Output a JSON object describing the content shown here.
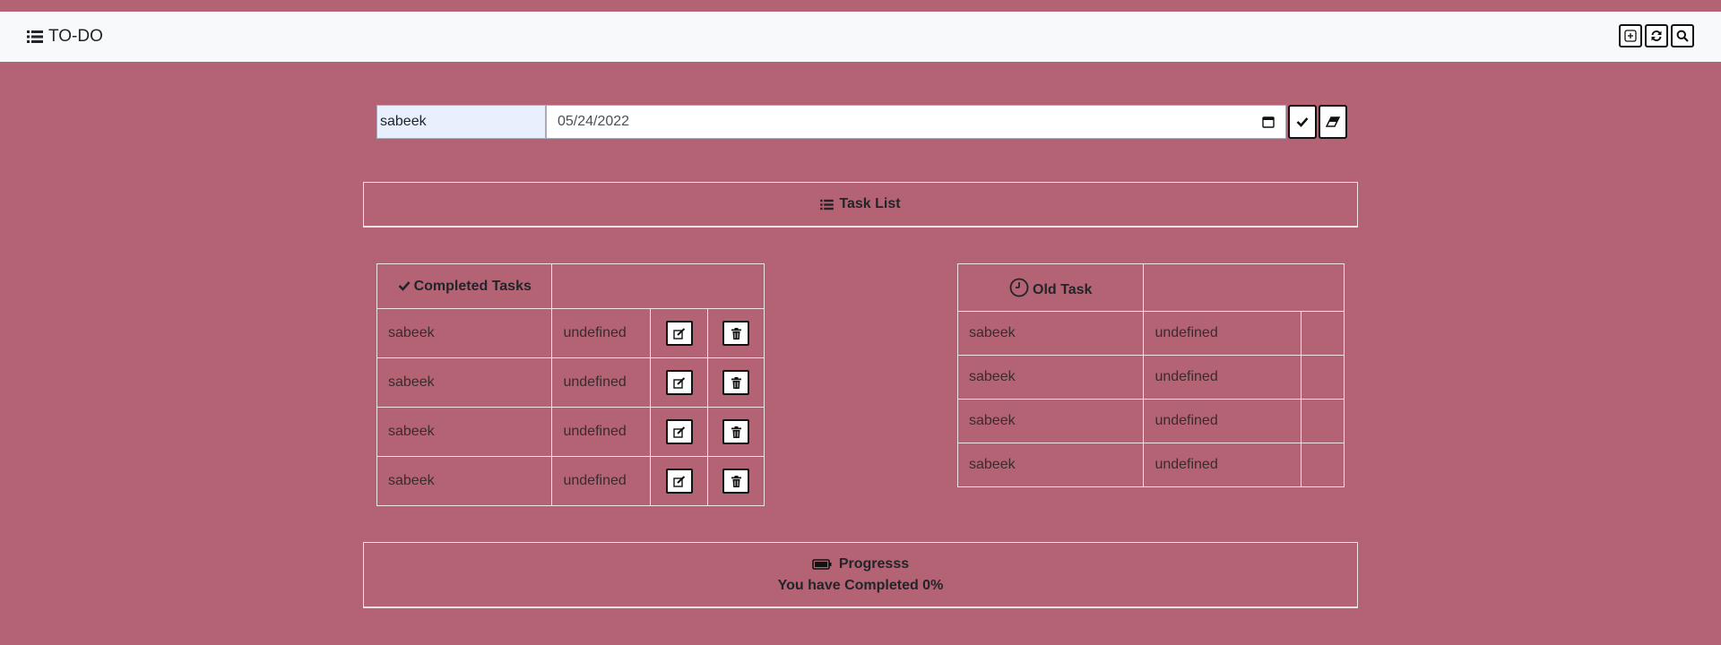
{
  "navbar": {
    "brand": "TO-DO",
    "brand_icon": "list-icon",
    "buttons": [
      "add-icon",
      "refresh-icon",
      "search-icon"
    ]
  },
  "form": {
    "name_value": "sabeek",
    "date_value": "05/24/2022",
    "submit_icon": "check-icon",
    "clear_icon": "eraser-icon"
  },
  "task_list": {
    "title": "Task List"
  },
  "completed": {
    "title": "Completed Tasks",
    "rows": [
      {
        "name": "sabeek",
        "date": "undefined"
      },
      {
        "name": "sabeek",
        "date": "undefined"
      },
      {
        "name": "sabeek",
        "date": "undefined"
      },
      {
        "name": "sabeek",
        "date": "undefined"
      }
    ]
  },
  "old": {
    "title": "Old Task",
    "rows": [
      {
        "name": "sabeek",
        "date": "undefined"
      },
      {
        "name": "sabeek",
        "date": "undefined"
      },
      {
        "name": "sabeek",
        "date": "undefined"
      },
      {
        "name": "sabeek",
        "date": "undefined"
      }
    ]
  },
  "progress": {
    "title": "Progresss",
    "message": "You have Completed 0%",
    "percent": 0
  },
  "colors": {
    "background": "#b36373",
    "navbar": "#f8f9fa",
    "border": "#f3e3e6"
  }
}
